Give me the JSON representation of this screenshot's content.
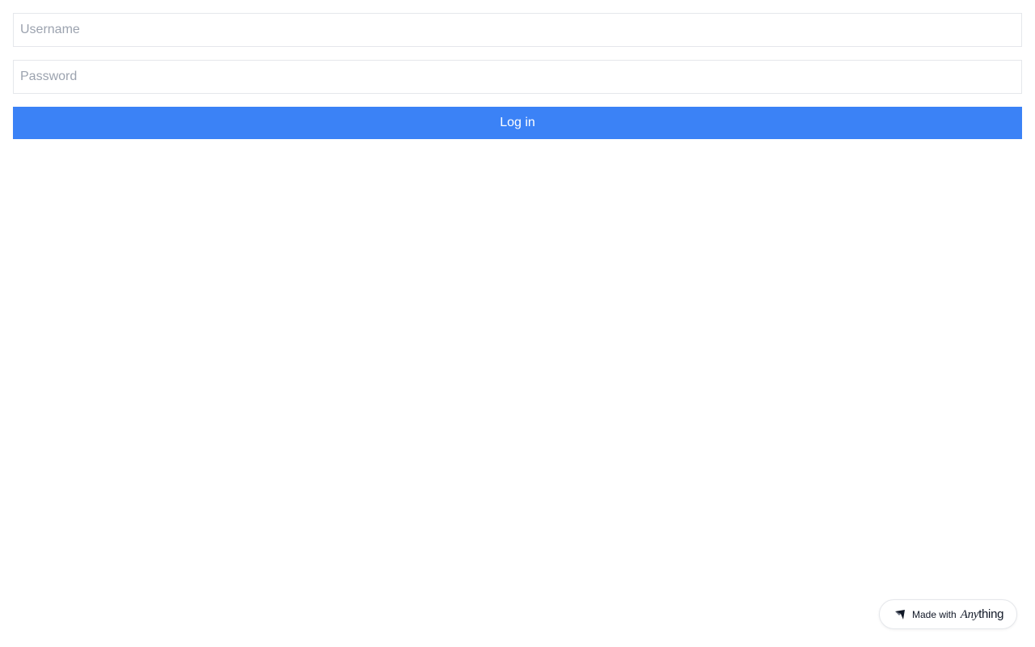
{
  "login": {
    "username_placeholder": "Username",
    "username_value": "",
    "password_placeholder": "Password",
    "password_value": "",
    "submit_label": "Log in"
  },
  "badge": {
    "prefix": "Made with",
    "brand_italic": "Any",
    "brand_regular": "thing",
    "icon": "anything-logo-icon"
  },
  "colors": {
    "primary_button": "#3b82f6",
    "input_border": "#e5e7eb",
    "placeholder": "#9ca3af"
  }
}
